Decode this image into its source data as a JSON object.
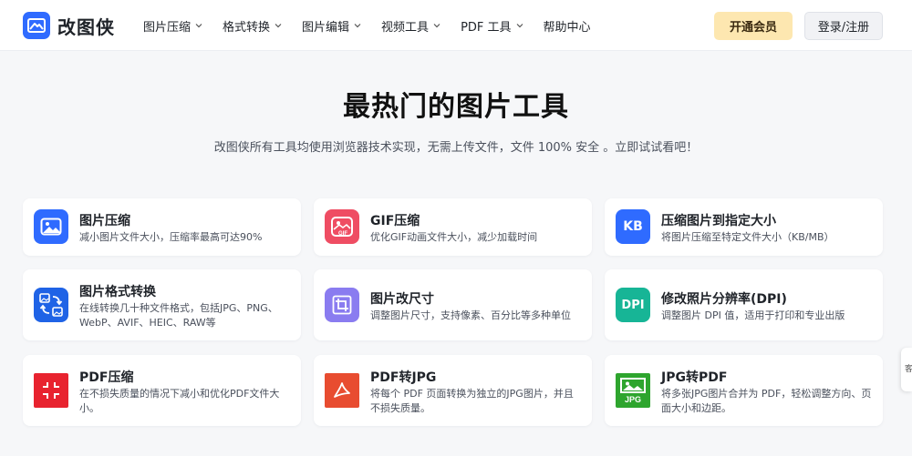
{
  "brand": {
    "name": "改图侠",
    "color": "#2f6bff"
  },
  "nav": [
    {
      "label": "图片压缩",
      "dropdown": true
    },
    {
      "label": "格式转换",
      "dropdown": true
    },
    {
      "label": "图片编辑",
      "dropdown": true
    },
    {
      "label": "视频工具",
      "dropdown": true
    },
    {
      "label": "PDF 工具",
      "dropdown": true
    },
    {
      "label": "帮助中心",
      "dropdown": false
    }
  ],
  "actions": {
    "vip_label": "开通会员",
    "login_label": "登录/注册"
  },
  "hero": {
    "title": "最热门的图片工具",
    "subtitle": "改图侠所有工具均使用浏览器技术实现，无需上传文件，文件 100% 安全 。立即试试看吧！"
  },
  "tools": [
    {
      "title": "图片压缩",
      "desc": "减小图片文件大小，压缩率最高可达90%",
      "icon": "image-icon",
      "color": "#2f6bff"
    },
    {
      "title": "GIF压缩",
      "desc": "优化GIF动画文件大小，减少加载时间",
      "icon": "gif-icon",
      "color": "#ef4d63",
      "icon_text": "GIF"
    },
    {
      "title": "压缩图片到指定大小",
      "desc": "将图片压缩至特定文件大小（KB/MB）",
      "icon": "kb-icon",
      "color": "#2f6bff",
      "icon_text": "KB"
    },
    {
      "title": "图片格式转换",
      "desc": "在线转换几十种文件格式，包括JPG、PNG、WebP、AVIF、HEIC、RAW等",
      "icon": "format-convert-icon",
      "color": "#1f63e6"
    },
    {
      "title": "图片改尺寸",
      "desc": "调整图片尺寸，支持像素、百分比等多种单位",
      "icon": "crop-icon",
      "color": "#8a7cf0"
    },
    {
      "title": "修改照片分辨率(DPI)",
      "desc": "调整图片 DPI 值，适用于打印和专业出版",
      "icon": "dpi-icon",
      "color": "#17b596",
      "icon_text": "DPI"
    },
    {
      "title": "PDF压缩",
      "desc": "在不损失质量的情况下减小和优化PDF文件大小。",
      "icon": "pdf-compress-icon",
      "color": "#e8232f"
    },
    {
      "title": "PDF转JPG",
      "desc": "将每个 PDF 页面转换为独立的JPG图片，并且不损失质量。",
      "icon": "pdf-icon",
      "color": "#e84c30"
    },
    {
      "title": "JPG转PDF",
      "desc": "将多张JPG图片合并为 PDF，轻松调整方向、页面大小和边距。",
      "icon": "jpg-icon",
      "color": "#2ea52e",
      "icon_text": "JPG"
    }
  ],
  "side_tab": {
    "label": "客"
  }
}
